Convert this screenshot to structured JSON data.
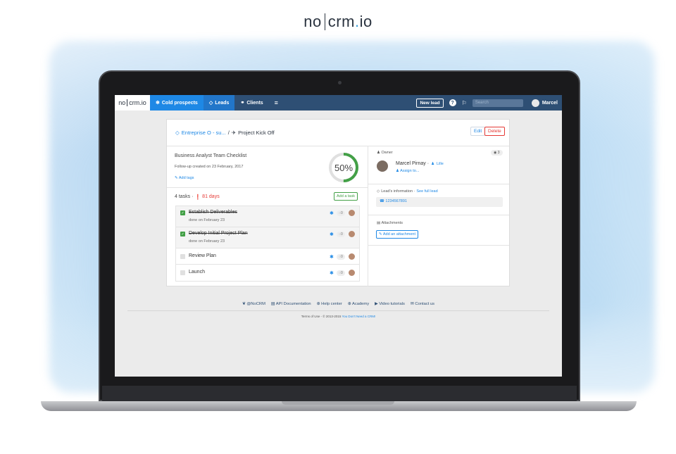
{
  "brand": {
    "part1": "no",
    "part2": "crm",
    "dot": ".",
    "part3": "io"
  },
  "navbar": {
    "logo": {
      "part1": "no",
      "part2": "crm.io"
    },
    "tabs": [
      {
        "icon": "snowflake-icon",
        "label": "Cold prospects"
      },
      {
        "icon": "diamond-icon",
        "label": "Leads"
      },
      {
        "icon": "handshake-icon",
        "label": "Clients"
      }
    ],
    "new_lead_label": "New lead",
    "help_label": "?",
    "search_placeholder": "Search",
    "user_name": "Marcel"
  },
  "lead": {
    "breadcrumb_lead": "Entreprise O - su...",
    "breadcrumb_sep": "/",
    "breadcrumb_title": "Project Kick Off",
    "edit_label": "Edit",
    "delete_label": "Delete",
    "checklist_title": "Business Analyst Team Checklist",
    "followup_text": "Follow-up created on 23 February, 2017",
    "add_tags_label": "Add tags",
    "progress_label": "50%",
    "progress_fraction": 0.5
  },
  "tasks": {
    "count_label": "4 tasks ·",
    "late_label": "81 days",
    "add_task_label": "Add a task",
    "items": [
      {
        "name": "Establish Deliverables",
        "sub": "done on February 23",
        "comments": "0",
        "done": true
      },
      {
        "name": "Develop Initial Project Plan",
        "sub": "done on February 23",
        "comments": "0",
        "done": true
      },
      {
        "name": "Review Plan",
        "comments": "0",
        "done": false
      },
      {
        "name": "Launch",
        "comments": "0",
        "done": false
      }
    ]
  },
  "sidebar": {
    "owner_label": "Owner",
    "views_count": "3",
    "owner_name": "Marcel Pirnay ·",
    "owner_city": "Lille",
    "assign_label": "Assign to...",
    "lead_info_label": "Lead's information ·",
    "see_full_label": "See full lead",
    "phone": "1234567891",
    "attachments_label": "Attachments",
    "add_attachment_label": "Add an attachment"
  },
  "footer": {
    "links": [
      "@NoCRM",
      "API Documentation",
      "Help center",
      "Academy",
      "Video tutorials",
      "Contact us"
    ],
    "legal_prefix": "Terms of Use - © 2013-2015",
    "legal_link": "You Don't Need a CRM!"
  },
  "colors": {
    "navbar": "#2e4f74",
    "accent": "#1e88e5",
    "success": "#43a047",
    "danger": "#e53935"
  }
}
